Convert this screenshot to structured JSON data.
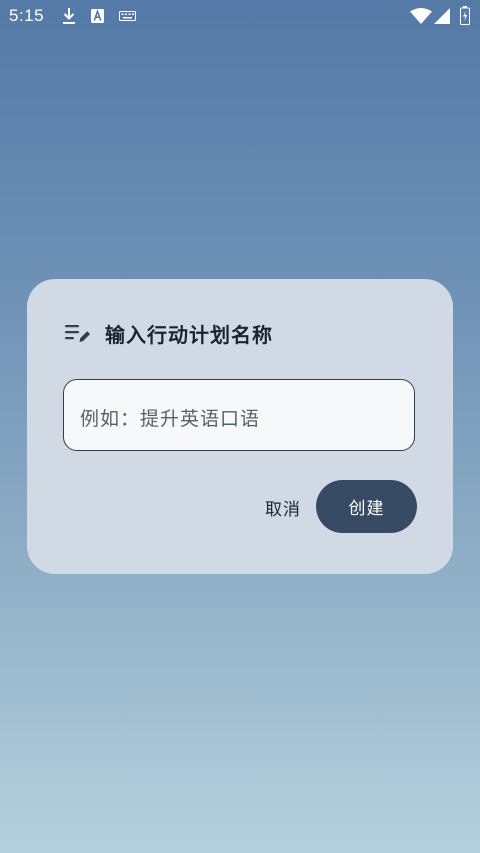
{
  "status_bar": {
    "time": "5:15",
    "icons": [
      "download-icon",
      "a-icon",
      "keyboard-icon",
      "wifi-icon",
      "signal-icon",
      "battery-icon"
    ]
  },
  "dialog": {
    "icon": "edit-list-icon",
    "title": "输入行动计划名称",
    "input": {
      "value": "",
      "placeholder": "例如：提升英语口语"
    },
    "cancel_label": "取消",
    "create_label": "创建"
  },
  "colors": {
    "dialog_bg": "#d1dae4",
    "primary_button": "#364a63",
    "input_border": "#2f3e51"
  }
}
